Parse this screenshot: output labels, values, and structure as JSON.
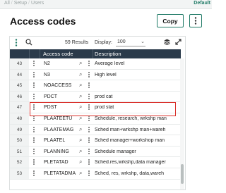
{
  "breadcrumbs": [
    "All",
    "Setup",
    "Users"
  ],
  "default_label": "Default",
  "page_title": "Access codes",
  "buttons": {
    "copy": "Copy"
  },
  "toolbar": {
    "results_count": "59",
    "results_label": "Results",
    "display_label": "Display:",
    "display_value": "100"
  },
  "columns": {
    "code": "Access code",
    "description": "Description"
  },
  "rows": [
    {
      "num": "43",
      "code": "N2",
      "desc": "Average level"
    },
    {
      "num": "44",
      "code": "N3",
      "desc": "High level"
    },
    {
      "num": "45",
      "code": "NOACCESS",
      "desc": ""
    },
    {
      "num": "46",
      "code": "PDCT",
      "desc": "prod cat"
    },
    {
      "num": "47",
      "code": "PDST",
      "desc": "prod stat"
    },
    {
      "num": "48",
      "code": "PLAATEETU",
      "desc": "Schedule, research, wrkshp man"
    },
    {
      "num": "49",
      "code": "PLAATEMAG",
      "desc": "Sched man+wrkshp man+wareh"
    },
    {
      "num": "50",
      "code": "PLAATEL",
      "desc": "Sched manager+workshop man"
    },
    {
      "num": "51",
      "code": "PLANNING",
      "desc": "Schedule manager"
    },
    {
      "num": "52",
      "code": "PLETATAD",
      "desc": "Sched.res,wrkshp,data manager"
    },
    {
      "num": "53",
      "code": "PLETATADMA",
      "desc": "Sched, res, wrkshp, data,wareh"
    }
  ],
  "colors": {
    "accent": "#1f7a66",
    "header_bg": "#2a3a4a",
    "highlight": "#d9302b"
  }
}
